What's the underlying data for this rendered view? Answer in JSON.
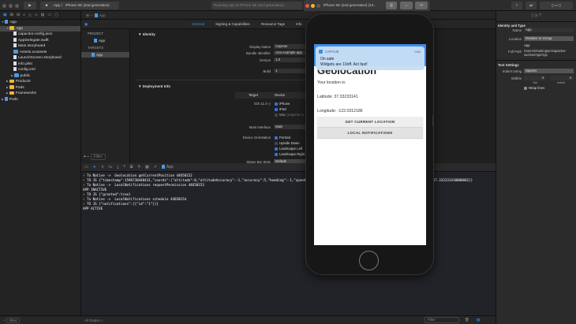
{
  "toolbar": {
    "scheme": "App",
    "device": "iPhone SE (2nd generation)",
    "status": "Running App on iPhone SE (2nd generation)"
  },
  "navigator": {
    "items": [
      {
        "label": "App",
        "type": "project",
        "depth": 0
      },
      {
        "label": "App",
        "type": "folder",
        "depth": 1,
        "selected": true
      },
      {
        "label": "capacitor.config.json",
        "type": "file",
        "depth": 2
      },
      {
        "label": "AppDelegate.swift",
        "type": "file",
        "depth": 2
      },
      {
        "label": "Main.storyboard",
        "type": "file",
        "depth": 2
      },
      {
        "label": "Assets.xcassets",
        "type": "bluefolder",
        "depth": 2
      },
      {
        "label": "LaunchScreen.storyboard",
        "type": "file",
        "depth": 2
      },
      {
        "label": "Info.plist",
        "type": "file",
        "depth": 2
      },
      {
        "label": "config.xml",
        "type": "file",
        "depth": 2
      },
      {
        "label": "public",
        "type": "bluefolder",
        "depth": 2
      },
      {
        "label": "Products",
        "type": "folder",
        "depth": 1
      },
      {
        "label": "Pods",
        "type": "folder",
        "depth": 1
      },
      {
        "label": "Frameworks",
        "type": "folder",
        "depth": 1
      },
      {
        "label": "Pods",
        "type": "project",
        "depth": 0
      }
    ],
    "filter_placeholder": "Filter"
  },
  "editor": {
    "breadcrumb": "App",
    "tabs": [
      "General",
      "Signing & Capabilities",
      "Resource Tags",
      "Info"
    ],
    "project_header": "PROJECT",
    "project_item": "App",
    "targets_header": "TARGETS",
    "target_item": "App",
    "list_filter": "Filter",
    "identity": {
      "title": "Identity",
      "display_name_label": "Display Name",
      "display_name": "CapVue",
      "bundle_label": "Bundle Identifier",
      "bundle": "com.example.app",
      "version_label": "Version",
      "version": "1.0",
      "build_label": "Build",
      "build": "1"
    },
    "deployment": {
      "title": "Deployment Info",
      "target_col": "Target",
      "device_col": "Device",
      "ios": "iOS 11.0 ◇",
      "iphone": "iPhone",
      "ipad": "iPad",
      "mac": "Mac",
      "mac_note": "(requires m",
      "main_interface_label": "Main Interface",
      "main_interface": "Main",
      "orientation_label": "Device Orientation",
      "portrait": "Portrait",
      "upside": "Upside Down",
      "land_left": "Landscape Left",
      "land_right": "Landscape Right",
      "status_bar_label": "Status Bar Style",
      "status_bar": "Default"
    }
  },
  "console": {
    "scheme": "App",
    "lines": [
      {
        "bolt": true,
        "text": "To Native ->  Geolocation getCurrentPosition 44650152"
      },
      {
        "bolt": true,
        "text": "TO JS {\"timestamp\":1596730440431,\"coords\":{\"altitude\":0,\"altitudeAccuracy\":-1,\"accuracy\":5,\"heading\":-1,\"speed\":-1,\"latitude\":37.3323314100000,\"longitude\":-122.0312186,\"lat\":37.332331410000002}}"
      },
      {
        "bolt": true,
        "text": "To Native ->  LocalNotifications requestPermission 44650153"
      },
      {
        "bolt": false,
        "text": "APP INACTIVE"
      },
      {
        "bolt": true,
        "text": "TO JS {\"granted\":true}"
      },
      {
        "bolt": true,
        "text": "To Native ->  LocalNotifications schedule 44650154"
      },
      {
        "bolt": true,
        "text": "TO JS {\"notifications\":[{\"id\":\"1\"}]}"
      },
      {
        "bolt": false,
        "text": "APP ACTIVE"
      }
    ],
    "output_select": "All Output ◇",
    "filter_placeholder": "Filter"
  },
  "inspector": {
    "identity_title": "Identity and Type",
    "name_label": "Name",
    "name": "App",
    "location_label": "Location",
    "location": "Relative to Group",
    "location_file": "App",
    "fullpath_label": "Full Path",
    "fullpath": "/Users/mhartington/capacitor-vue/ios/App/App",
    "text_title": "Text Settings",
    "indent_label": "Indent Using",
    "indent": "Spaces",
    "widths_label": "Widths",
    "tab": "4",
    "indent_w": "4",
    "tab_label": "Tab",
    "indent_label2": "Indent",
    "wrap": "Wrap lines"
  },
  "simulator": {
    "title": "iPhone SE (2nd generation) (13...",
    "notification": {
      "app": "CAPVUE",
      "time": "now",
      "title": "On sale",
      "body": "Widgets are 10off. Act fast!"
    },
    "heading": "Geolocation",
    "location_label": "Your location is:",
    "latitude": "Latitude: 37.33233141",
    "longitude": "Longitude: -122.0312186",
    "btn_location": "GET CURRENT LOCATION",
    "btn_notifications": "LOCAL NOTIFICATIONS"
  },
  "colors": {
    "accent": "#3b8eea",
    "bolt": "#f5c02a",
    "notification": "#c8def5"
  }
}
